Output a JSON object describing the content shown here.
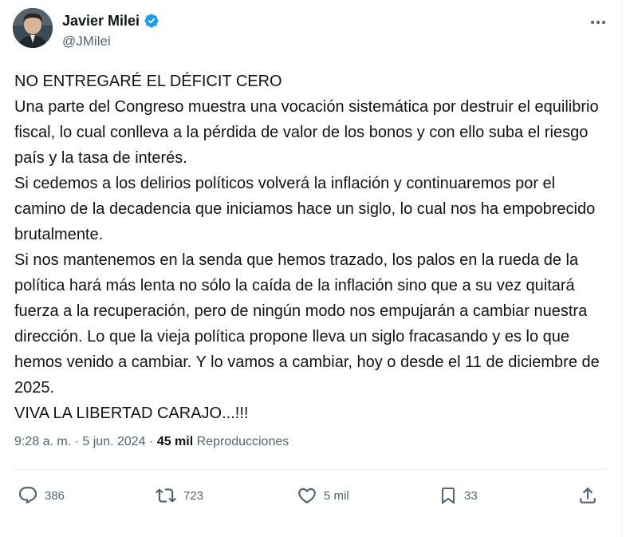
{
  "author": {
    "display_name": "Javier Milei",
    "handle": "@JMilei",
    "verified": true
  },
  "tweet": {
    "paragraphs": [
      "NO ENTREGARÉ EL DÉFICIT CERO",
      "Una parte del Congreso muestra una vocación sistemática por destruir el equilibrio fiscal, lo cual conlleva a la pérdida de valor de los bonos y con ello suba el riesgo país y la tasa de interés.",
      "Si cedemos a los delirios políticos volverá la inflación y continuaremos por el camino de la decadencia que iniciamos hace un siglo, lo cual nos ha empobrecido brutalmente.",
      "Si nos mantenemos en la senda que hemos trazado, los palos en la rueda de la política hará más lenta no sólo la caída de la inflación sino que a su vez quitará fuerza a la recuperación, pero de ningún modo nos empujarán a cambiar nuestra dirección. Lo que la vieja política propone lleva un siglo fracasando y es lo que hemos venido a cambiar. Y lo vamos a cambiar, hoy o desde el 11 de diciembre de 2025.",
      "VIVA LA LIBERTAD CARAJO...!!!"
    ]
  },
  "meta": {
    "time": "9:28 a. m.",
    "separator": "·",
    "date": "5 jun. 2024",
    "views_count": "45 mil",
    "views_label": "Reproducciones"
  },
  "actions": {
    "replies": "386",
    "reposts": "723",
    "likes": "5 mil",
    "bookmarks": "33"
  },
  "colors": {
    "text": "#0f1419",
    "secondary": "#536471",
    "verified_blue": "#1d9bf0",
    "border": "#eff3f4"
  }
}
